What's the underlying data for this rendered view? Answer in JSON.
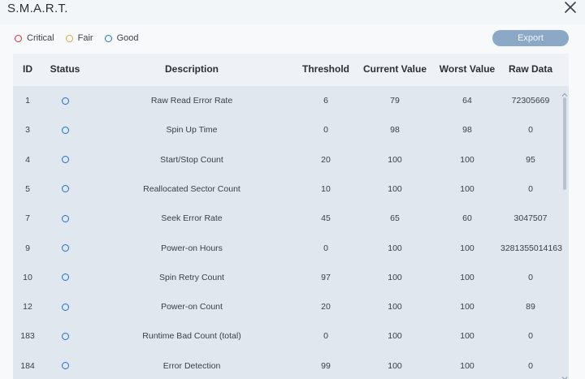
{
  "window": {
    "title": "S.M.A.R.T."
  },
  "icons": {
    "close": "close-icon",
    "status": "ring-icon"
  },
  "colors": {
    "critical": "#d62b3a",
    "fair": "#e8a33d",
    "good": "#1b6fd6",
    "export_button": "#8ba9c6"
  },
  "legend": [
    {
      "label": "Critical",
      "color": "#d62b3a"
    },
    {
      "label": "Fair",
      "color": "#e8a33d"
    },
    {
      "label": "Good",
      "color": "#1b6fd6"
    }
  ],
  "toolbar": {
    "export_label": "Export"
  },
  "table": {
    "columns": [
      "ID",
      "Status",
      "Description",
      "Threshold",
      "Current Value",
      "Worst Value",
      "Raw Data"
    ],
    "rows": [
      {
        "id": "1",
        "status": "good",
        "description": "Raw Read Error Rate",
        "threshold": "6",
        "current": "79",
        "worst": "64",
        "raw": "72305669"
      },
      {
        "id": "3",
        "status": "good",
        "description": "Spin Up Time",
        "threshold": "0",
        "current": "98",
        "worst": "98",
        "raw": "0"
      },
      {
        "id": "4",
        "status": "good",
        "description": "Start/Stop Count",
        "threshold": "20",
        "current": "100",
        "worst": "100",
        "raw": "95"
      },
      {
        "id": "5",
        "status": "good",
        "description": "Reallocated Sector Count",
        "threshold": "10",
        "current": "100",
        "worst": "100",
        "raw": "0"
      },
      {
        "id": "7",
        "status": "good",
        "description": "Seek Error Rate",
        "threshold": "45",
        "current": "65",
        "worst": "60",
        "raw": "3047507"
      },
      {
        "id": "9",
        "status": "good",
        "description": "Power-on Hours",
        "threshold": "0",
        "current": "100",
        "worst": "100",
        "raw": "3281355014163"
      },
      {
        "id": "10",
        "status": "good",
        "description": "Spin Retry Count",
        "threshold": "97",
        "current": "100",
        "worst": "100",
        "raw": "0"
      },
      {
        "id": "12",
        "status": "good",
        "description": "Power-on Count",
        "threshold": "20",
        "current": "100",
        "worst": "100",
        "raw": "89"
      },
      {
        "id": "183",
        "status": "good",
        "description": "Runtime Bad Count (total)",
        "threshold": "0",
        "current": "100",
        "worst": "100",
        "raw": "0"
      },
      {
        "id": "184",
        "status": "good",
        "description": "Error Detection",
        "threshold": "99",
        "current": "100",
        "worst": "100",
        "raw": "0"
      }
    ]
  }
}
